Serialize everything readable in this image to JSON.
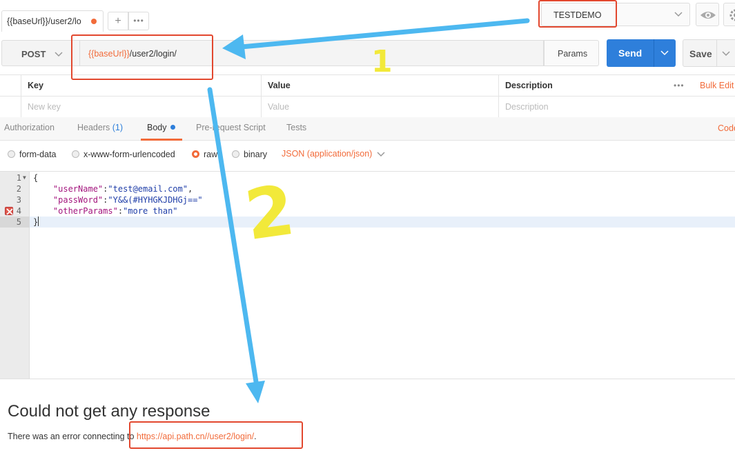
{
  "tabs": {
    "request_tab_title": "{{baseUrl}}/user2/lo",
    "new_tab_label": "+",
    "more_label": "•••"
  },
  "environment": {
    "selected": "TESTDEMO"
  },
  "request": {
    "method": "POST",
    "url_variable": "{{baseUrl}}",
    "url_path": "/user2/login/",
    "params_label": "Params",
    "send_label": "Send",
    "save_label": "Save"
  },
  "params_table": {
    "headers": [
      "Key",
      "Value",
      "Description"
    ],
    "placeholders": [
      "New key",
      "Value",
      "Description"
    ],
    "more_label": "•••",
    "bulk_edit_label": "Bulk Edit"
  },
  "subtabs": {
    "items": [
      "Authorization",
      "Headers",
      "Body",
      "Pre-request Script",
      "Tests"
    ],
    "headers_count": "(1)",
    "code_label": "Code"
  },
  "body_types": {
    "options": [
      "form-data",
      "x-www-form-urlencoded",
      "raw",
      "binary"
    ],
    "selected": "raw",
    "content_type": "JSON (application/json)"
  },
  "editor": {
    "lines": [
      {
        "num": "1",
        "text": "{"
      },
      {
        "num": "2",
        "key": "\"userName\"",
        "value": "\"test@email.com\"",
        "suffix": ","
      },
      {
        "num": "3",
        "key": "\"passWord\"",
        "value": "\"Y&&(#HYHGKJDHGj==\"",
        "suffix": ""
      },
      {
        "num": "4",
        "key": "\"otherParams\"",
        "value": "\"more than\"",
        "suffix": ""
      },
      {
        "num": "5",
        "text": "}"
      }
    ],
    "error_line": 4
  },
  "response": {
    "title": "Could not get any response",
    "message_prefix": "There was an error connecting to ",
    "message_link": "https://api.path.cn//user2/login/",
    "message_suffix": "."
  },
  "annotations": {
    "mark_1": "1",
    "mark_2": "2",
    "arrow_color": "#4db8f0",
    "box_color": "#e2472e",
    "mark_color": "#f2e93a"
  },
  "colors": {
    "accent": "#f26b3a",
    "send": "#2e7fdb"
  }
}
